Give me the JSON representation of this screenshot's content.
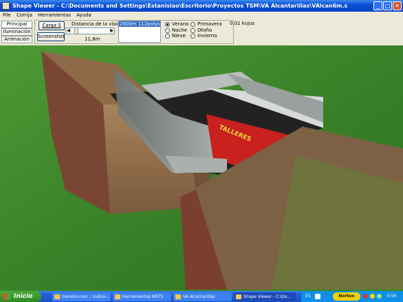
{
  "window": {
    "title": "Shape Viewer - C:\\Documents and Settings\\Estanislao\\Escritorio\\Proyectos TSM\\VA Alcantarillas\\VAlcan6m.s"
  },
  "window_buttons": {
    "minimize": "_",
    "maximize": "□",
    "close": "✕"
  },
  "menu": [
    "File",
    "Corrija",
    "Herramientas",
    "Ayuda"
  ],
  "tabs": [
    "Principal",
    "Iluminación",
    "Animación"
  ],
  "buttons": {
    "load": "Carga S",
    "screenshot": "Screenshot"
  },
  "view_distance": {
    "label": "Distancia de la visión",
    "value": "11,8m",
    "left_arrow": "◀",
    "right_arrow": "▶"
  },
  "lod_list": {
    "selected": "2000m 112polys"
  },
  "seasons": {
    "col1": [
      {
        "label": "Verano",
        "checked": true
      },
      {
        "label": "Noche",
        "checked": false
      },
      {
        "label": "Nieve",
        "checked": false
      }
    ],
    "col2": [
      {
        "label": "Primavera",
        "checked": false
      },
      {
        "label": "Otoño",
        "checked": false
      },
      {
        "label": "Invierno",
        "checked": false
      }
    ]
  },
  "stats": {
    "label": "0,01 kujus"
  },
  "scene": {
    "sign_text": "TALLERES",
    "colors": {
      "grass": "#3d8b2c",
      "brick": "#8a4a36",
      "metal": "#b9bdbb",
      "sign": "#c8211e"
    }
  },
  "taskbar": {
    "start_label": "Inicio",
    "items": [
      {
        "label": "trensim.com :: Indice...",
        "icon": "browser-icon",
        "active": false
      },
      {
        "label": "Herramientas MSTS",
        "icon": "folder-icon",
        "active": false
      },
      {
        "label": "VA Alcantarillas",
        "icon": "folder-icon",
        "active": false
      },
      {
        "label": "Shape Viewer - C:\\Do...",
        "icon": "shape-viewer-icon",
        "active": true
      }
    ],
    "lang": "ES",
    "norton": "Norton",
    "clock": "0:56"
  }
}
